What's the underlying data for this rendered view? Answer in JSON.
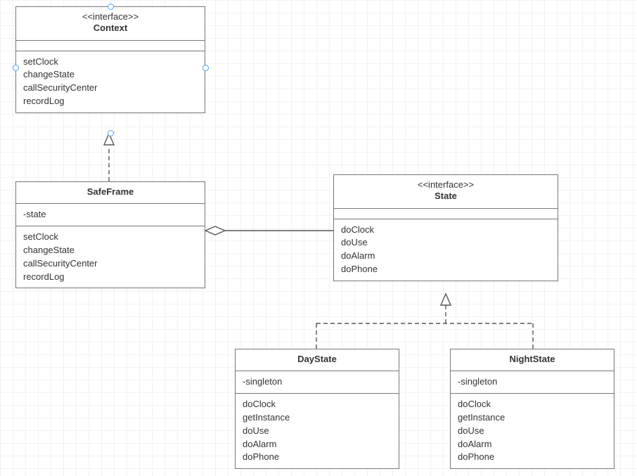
{
  "classes": {
    "context": {
      "stereotype": "<<interface>>",
      "name": "Context",
      "attributes": [],
      "operations": [
        "setClock",
        "changeState",
        "callSecurityCenter",
        "recordLog"
      ]
    },
    "safeFrame": {
      "stereotype": "",
      "name": "SafeFrame",
      "attributes": [
        "-state"
      ],
      "operations": [
        "setClock",
        "changeState",
        "callSecurityCenter",
        "recordLog"
      ]
    },
    "state": {
      "stereotype": "<<interface>>",
      "name": "State",
      "attributes": [],
      "operations": [
        "doClock",
        "doUse",
        "doAlarm",
        "doPhone"
      ]
    },
    "dayState": {
      "stereotype": "",
      "name": "DayState",
      "attributes": [
        "-singleton"
      ],
      "operations": [
        "doClock",
        "getInstance",
        "doUse",
        "doAlarm",
        "doPhone"
      ]
    },
    "nightState": {
      "stereotype": "",
      "name": "NightState",
      "attributes": [
        "-singleton"
      ],
      "operations": [
        "doClock",
        "getInstance",
        "doUse",
        "doAlarm",
        "doPhone"
      ]
    }
  },
  "chart_data": {
    "type": "uml-class-diagram",
    "classes": [
      {
        "id": "Context",
        "stereotype": "interface",
        "attributes": [],
        "operations": [
          "setClock",
          "changeState",
          "callSecurityCenter",
          "recordLog"
        ]
      },
      {
        "id": "SafeFrame",
        "attributes": [
          "-state"
        ],
        "operations": [
          "setClock",
          "changeState",
          "callSecurityCenter",
          "recordLog"
        ]
      },
      {
        "id": "State",
        "stereotype": "interface",
        "attributes": [],
        "operations": [
          "doClock",
          "doUse",
          "doAlarm",
          "doPhone"
        ]
      },
      {
        "id": "DayState",
        "attributes": [
          "-singleton"
        ],
        "operations": [
          "doClock",
          "getInstance",
          "doUse",
          "doAlarm",
          "doPhone"
        ]
      },
      {
        "id": "NightState",
        "attributes": [
          "-singleton"
        ],
        "operations": [
          "doClock",
          "getInstance",
          "doUse",
          "doAlarm",
          "doPhone"
        ]
      }
    ],
    "relationships": [
      {
        "from": "SafeFrame",
        "to": "Context",
        "type": "realization"
      },
      {
        "from": "SafeFrame",
        "to": "State",
        "type": "aggregation"
      },
      {
        "from": "DayState",
        "to": "State",
        "type": "realization"
      },
      {
        "from": "NightState",
        "to": "State",
        "type": "realization"
      }
    ]
  }
}
